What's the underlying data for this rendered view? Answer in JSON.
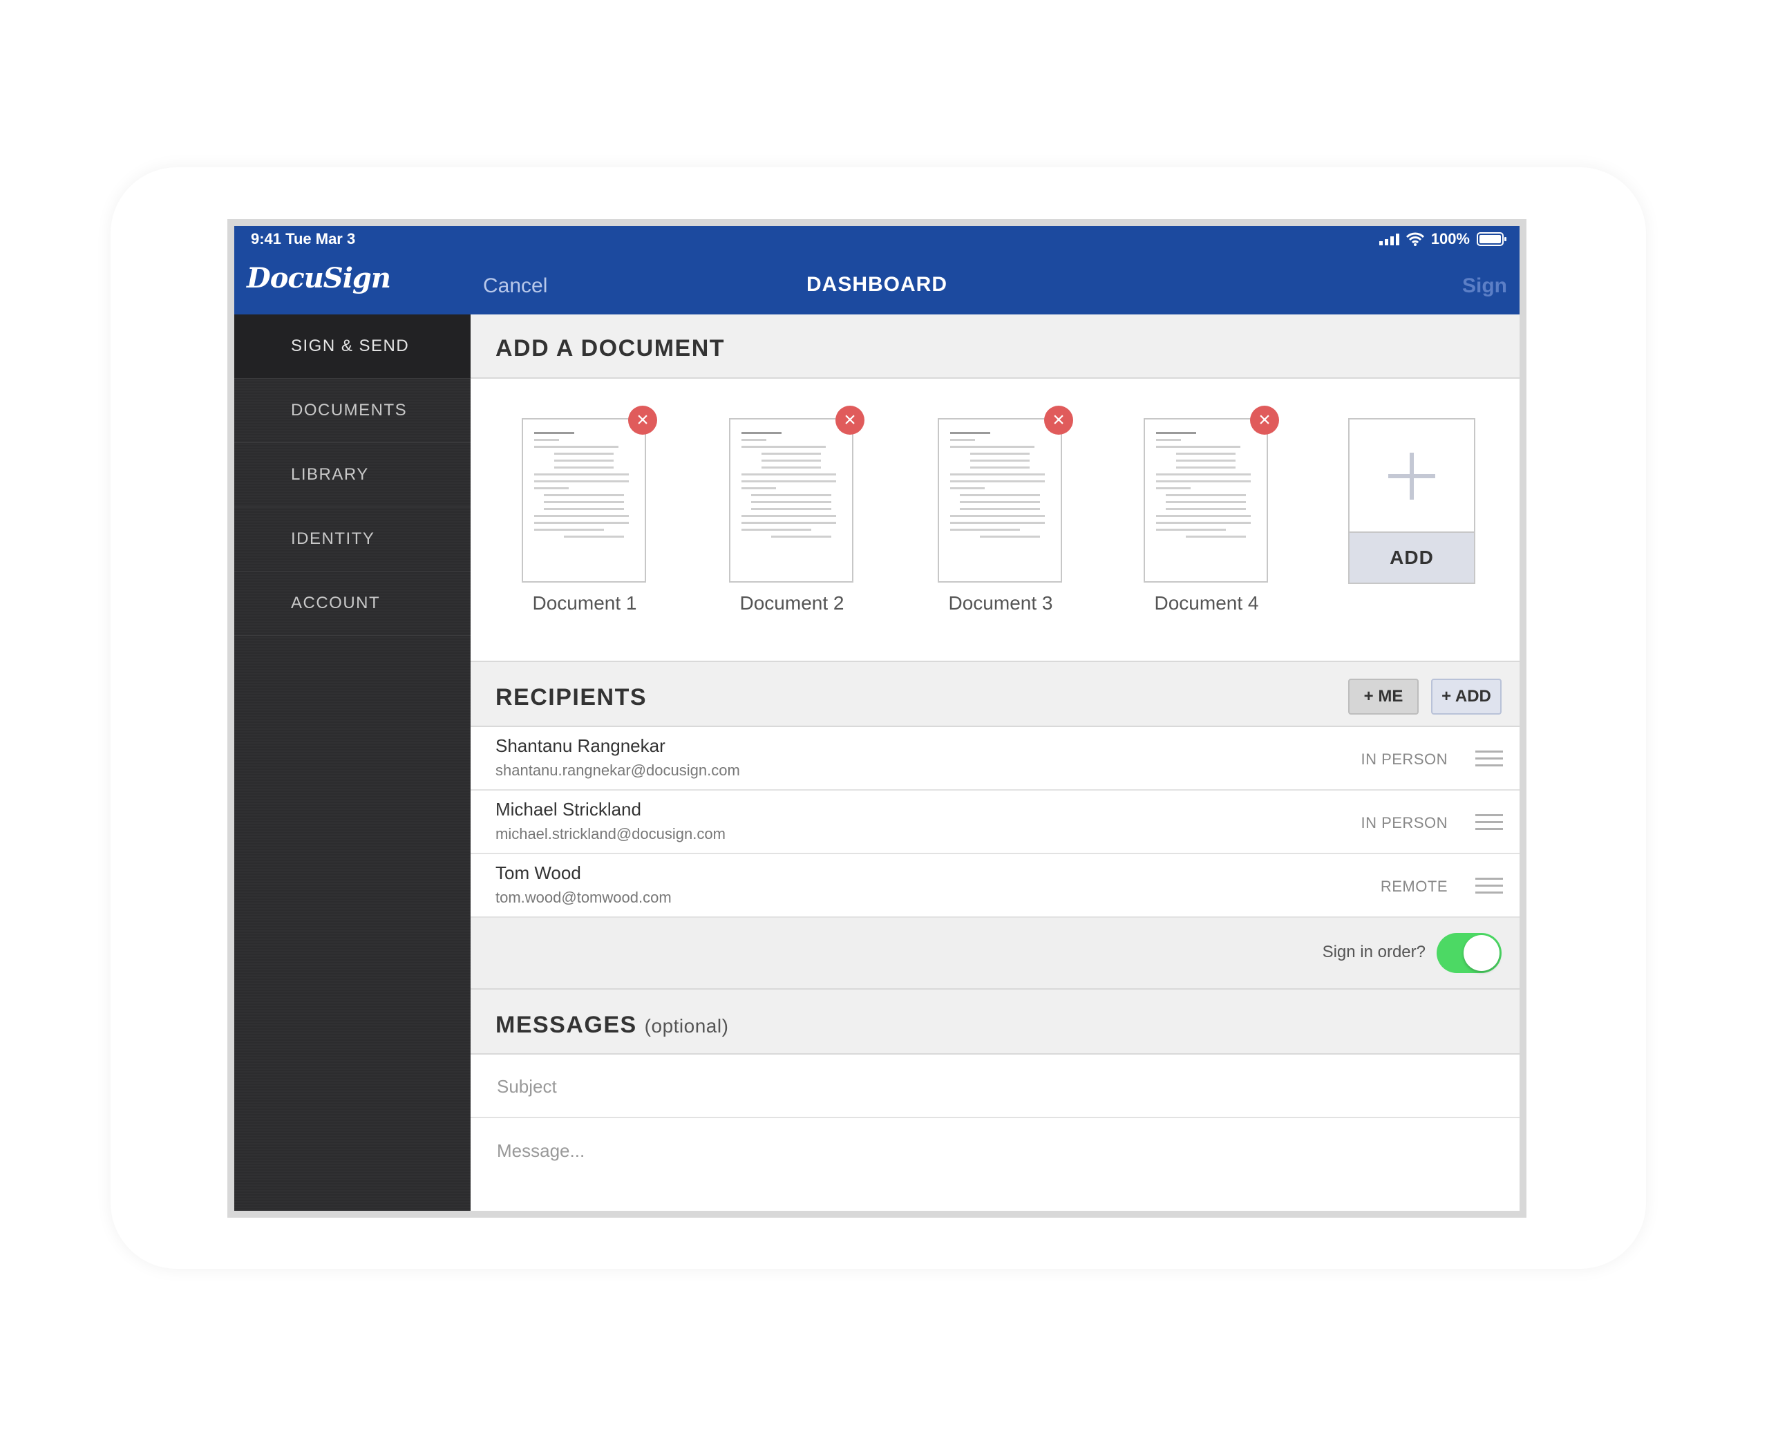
{
  "status_bar": {
    "time": "9:41  Tue Mar 3",
    "battery": "100%"
  },
  "header": {
    "logo": "DocuSign",
    "cancel_label": "Cancel",
    "title": "DASHBOARD",
    "sign_label": "Sign"
  },
  "sidebar": {
    "items": [
      {
        "label": "SIGN & SEND"
      },
      {
        "label": "DOCUMENTS"
      },
      {
        "label": "LIBRARY"
      },
      {
        "label": "IDENTITY"
      },
      {
        "label": "ACCOUNT"
      }
    ]
  },
  "documents": {
    "title": "ADD A DOCUMENT",
    "items": [
      {
        "label": "Document 1"
      },
      {
        "label": "Document 2"
      },
      {
        "label": "Document 3"
      },
      {
        "label": "Document 4"
      }
    ],
    "add_label": "ADD"
  },
  "recipients": {
    "title": "RECIPIENTS",
    "me_button": "+ ME",
    "add_button": "+ ADD",
    "items": [
      {
        "name": "Shantanu Rangnekar",
        "email": "shantanu.rangnekar@docusign.com",
        "type": "IN PERSON"
      },
      {
        "name": "Michael Strickland",
        "email": "michael.strickland@docusign.com",
        "type": "IN PERSON"
      },
      {
        "name": "Tom Wood",
        "email": "tom.wood@tomwood.com",
        "type": "REMOTE"
      }
    ],
    "sign_in_order_label": "Sign in order?",
    "sign_in_order": true
  },
  "messages": {
    "title": "MESSAGES",
    "optional": "(optional)",
    "subject_placeholder": "Subject",
    "message_placeholder": "Message..."
  },
  "colors": {
    "header": "#1c4a9f",
    "sidebar": "#2c2c2e",
    "toggle_on": "#4cd964",
    "remove": "#e05b5b"
  }
}
